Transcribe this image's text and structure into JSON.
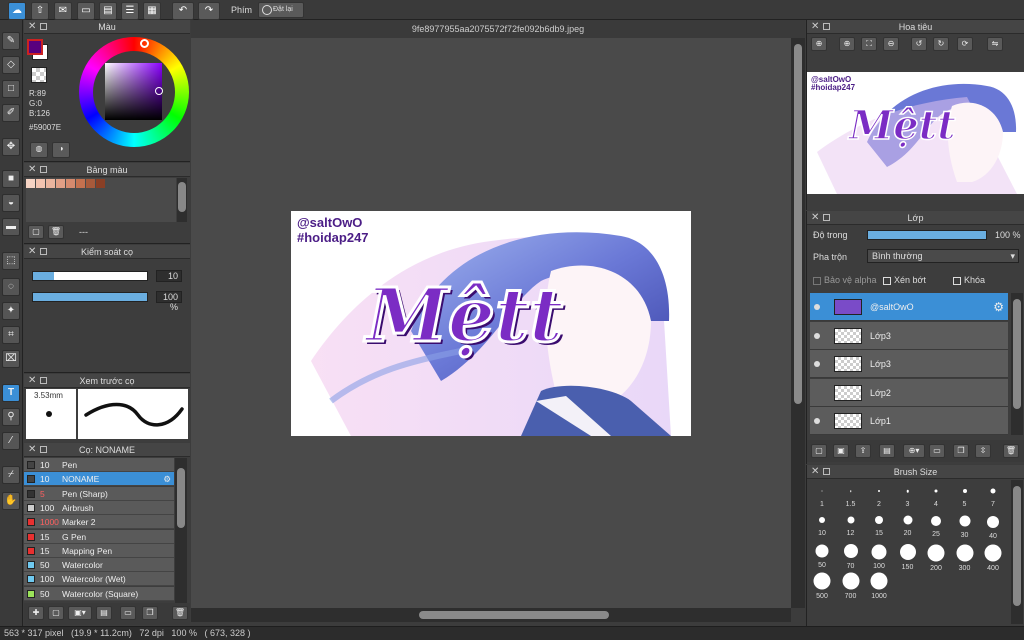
{
  "toolbar": {
    "shortcut_label": "Phím",
    "reset_label": "Đặt lại"
  },
  "canvas": {
    "tab_title": "9fe8977955aa2075572f72fe092b6db9.jpeg"
  },
  "artwork": {
    "handle": "@saltOwO",
    "tag": "#hoidap247",
    "title_text": "Mệtt"
  },
  "color_panel": {
    "title": "Màu",
    "r": "R:89",
    "g": "G:0",
    "b": "B:126",
    "hex": "#59007E",
    "main_color": "#59007E"
  },
  "palette_panel": {
    "title": "Bảng màu",
    "swatches": [
      "#f5d3c4",
      "#f2c3b0",
      "#eab49e",
      "#e19f86",
      "#d58a6e",
      "#c4714f",
      "#a75a3b",
      "#8a3f25"
    ],
    "dash": "---"
  },
  "brush_control": {
    "title": "Kiểm soát cọ",
    "size_value": "10",
    "opacity_value": "100 %",
    "size_fraction": 0.18,
    "opacity_fraction": 1.0
  },
  "brush_preview": {
    "title": "Xem trước cọ",
    "size_label": "3.53mm"
  },
  "brush_list": {
    "title": "Cọ: NONAME",
    "items": [
      {
        "size": "10",
        "name": "Pen",
        "color": "#444444"
      },
      {
        "size": "10",
        "name": "NONAME",
        "color": "#444444"
      },
      {
        "size": "5",
        "name": "Pen (Sharp)",
        "color": "#333333"
      },
      {
        "size": "100",
        "name": "Airbrush",
        "color": "#cccccc"
      },
      {
        "size": "1000",
        "name": "Marker 2",
        "color": "#e83030"
      },
      {
        "size": "15",
        "name": "G Pen",
        "color": "#e83030"
      },
      {
        "size": "15",
        "name": "Mapping Pen",
        "color": "#e83030"
      },
      {
        "size": "50",
        "name": "Watercolor",
        "color": "#6fc9f0"
      },
      {
        "size": "100",
        "name": "Watercolor (Wet)",
        "color": "#6fc9f0"
      },
      {
        "size": "50",
        "name": "Watercolor (Square)",
        "color": "#9be35a"
      }
    ]
  },
  "navigator": {
    "title": "Hoa tiêu"
  },
  "layers": {
    "title": "Lớp",
    "opacity_label": "Độ trong",
    "opacity_value": "100 %",
    "opacity_fraction": 1.0,
    "blend_label": "Pha trộn",
    "blend_value": "Bình thường",
    "protect_alpha": "Bảo vệ alpha",
    "clipping": "Xén bớt",
    "lock": "Khóa",
    "items": [
      "@saltOwO",
      "Lớp3",
      "Lớp3",
      "Lớp2",
      "Lớp1"
    ]
  },
  "brush_size": {
    "title": "Brush Size",
    "sizes": [
      "1",
      "1.5",
      "2",
      "3",
      "4",
      "5",
      "7",
      "10",
      "12",
      "15",
      "20",
      "25",
      "30",
      "40",
      "50",
      "70",
      "100",
      "150",
      "200",
      "300",
      "400",
      "500",
      "700",
      "1000"
    ]
  },
  "status": {
    "text": "563 * 317 pixel   (19.9 * 11.2cm)   72 dpi   100 %   ( 673, 328 )"
  }
}
